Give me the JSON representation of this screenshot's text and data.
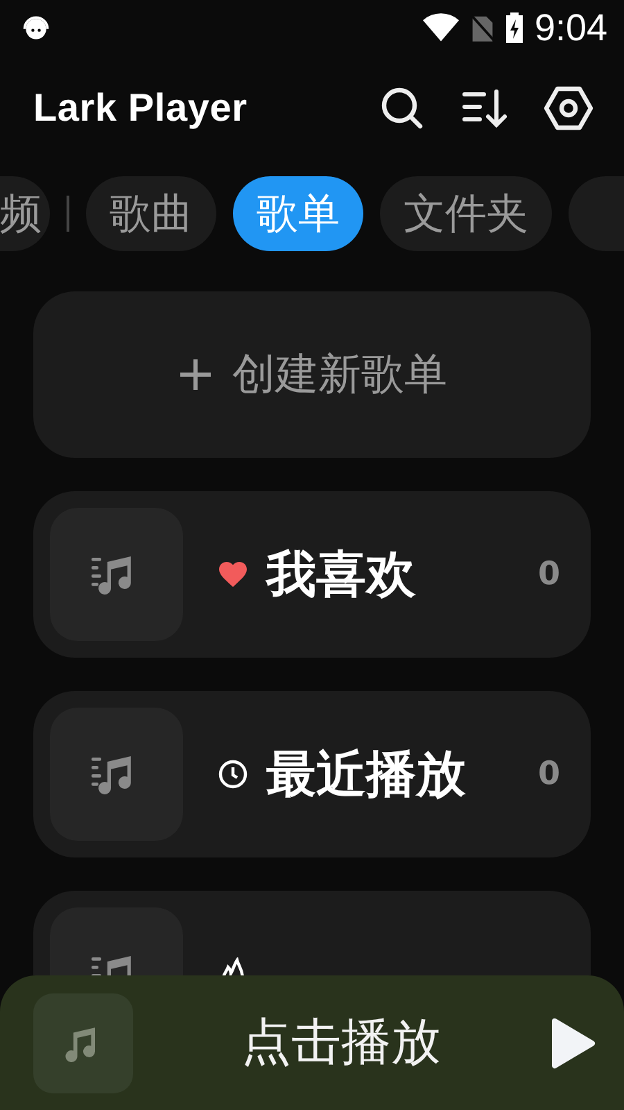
{
  "status_bar": {
    "time": "9:04"
  },
  "header": {
    "title": "Lark Player"
  },
  "tabs": [
    {
      "label": "频",
      "selected": false
    },
    {
      "label": "歌曲",
      "selected": false
    },
    {
      "label": "歌单",
      "selected": true
    },
    {
      "label": "文件夹",
      "selected": false
    }
  ],
  "create_playlist": {
    "label": "创建新歌单"
  },
  "playlists": [
    {
      "kind": "favorite",
      "name": "我喜欢",
      "count": "0"
    },
    {
      "kind": "recent",
      "name": "最近播放",
      "count": "0"
    },
    {
      "kind": "most"
    }
  ],
  "mini_player": {
    "label": "点击播放"
  }
}
